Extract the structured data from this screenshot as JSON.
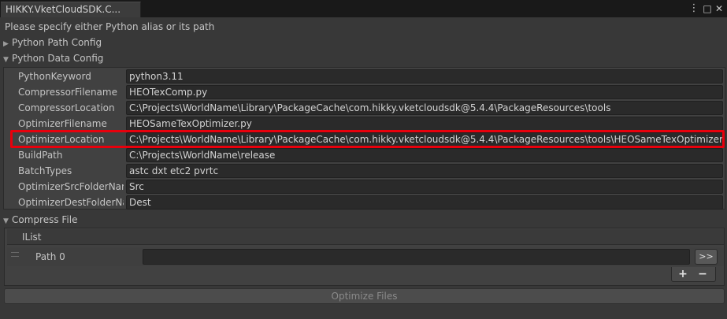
{
  "window": {
    "tab_title": "HIKKY.VketCloudSDK.C...",
    "menu_icon": "⋮",
    "maximize_icon": "□",
    "close_icon": "✕"
  },
  "hint": "Please specify either Python alias or its path",
  "python_path_config": {
    "label": "Python Path Config",
    "expanded": false
  },
  "python_data_config": {
    "label": "Python Data Config",
    "expanded": true,
    "fields": [
      {
        "label": "PythonKeyword",
        "value": "python3.11"
      },
      {
        "label": "CompressorFilename",
        "value": "HEOTexComp.py"
      },
      {
        "label": "CompressorLocation",
        "value": "C:\\Projects\\WorldName\\Library\\PackageCache\\com.hikky.vketcloudsdk@5.4.4\\PackageResources\\tools"
      },
      {
        "label": "OptimizerFilename",
        "value": "HEOSameTexOptimizer.py"
      },
      {
        "label": "OptimizerLocation",
        "value": "C:\\Projects\\WorldName\\Library\\PackageCache\\com.hikky.vketcloudsdk@5.4.4\\PackageResources\\tools\\HEOSameTexOptimizer"
      },
      {
        "label": "BuildPath",
        "value": "C:\\Projects\\WorldName\\release"
      },
      {
        "label": "BatchTypes",
        "value": "astc dxt etc2 pvrtc"
      },
      {
        "label": "OptimizerSrcFolderNam",
        "value": "Src"
      },
      {
        "label": "OptimizerDestFolderNar",
        "value": "Dest"
      }
    ]
  },
  "compress_file": {
    "label": "Compress File",
    "expanded": true,
    "list_title": "IList",
    "items": [
      {
        "label": "Path 0",
        "value": ""
      }
    ],
    "browse_label": ">>",
    "add_label": "+",
    "remove_label": "−"
  },
  "optimize_button": "Optimize Files",
  "colors": {
    "highlight": "#e8000c",
    "background": "#383838",
    "field": "#2a2a2a"
  }
}
